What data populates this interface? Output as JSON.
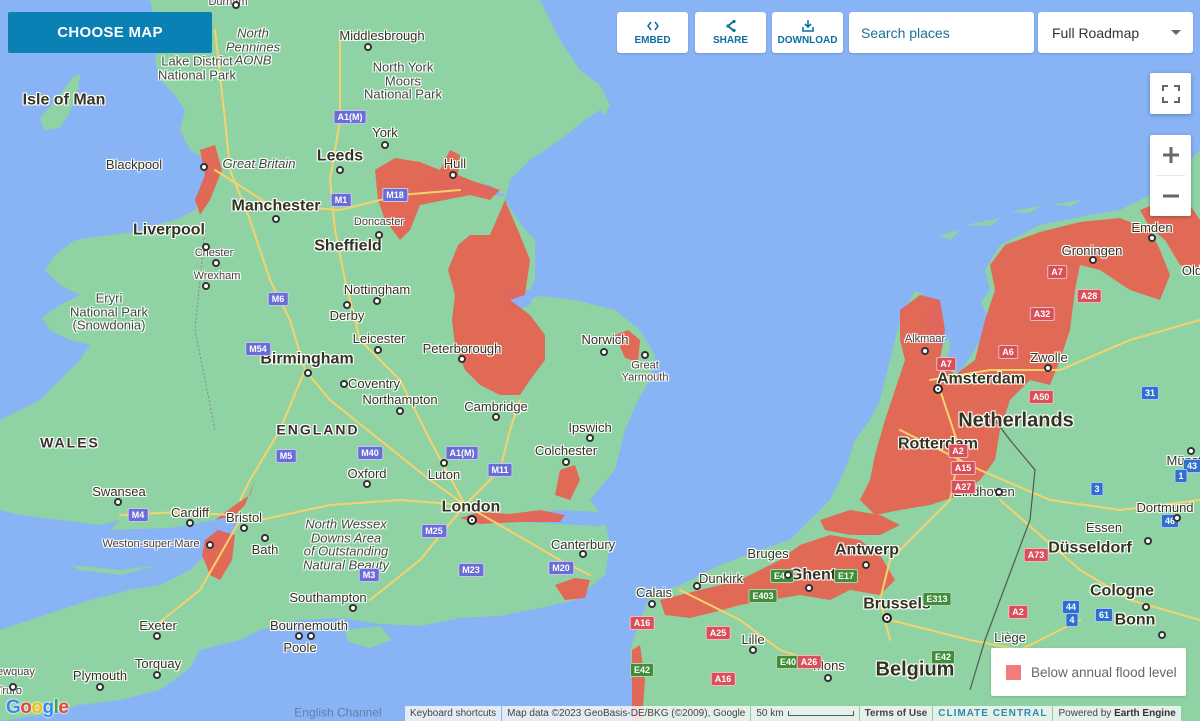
{
  "toolbar": {
    "choose_map_label": "CHOOSE MAP",
    "embed_label": "EMBED",
    "share_label": "SHARE",
    "download_label": "DOWNLOAD",
    "search_placeholder": "Search places",
    "map_type_selected": "Full Roadmap",
    "icons": {
      "embed": "code-brackets-icon",
      "share": "share-icon",
      "download": "download-icon",
      "search": "search-icon",
      "dropdown": "caret-down-icon",
      "fullscreen": "fullscreen-icon",
      "zoom_in": "plus-icon",
      "zoom_out": "minus-icon"
    }
  },
  "legend": {
    "label": "Below annual flood level",
    "color": "#f47b7b"
  },
  "colors": {
    "accent": "#0b80b4",
    "sea": "#88b3f5",
    "land": "#8fd3a4",
    "flood": "#e8614f"
  },
  "attribution": {
    "keyboard_shortcuts": "Keyboard shortcuts",
    "map_data": "Map data ©2023 GeoBasis-DE/BKG (©2009), Google",
    "scale": "50 km",
    "terms": "Terms of Use",
    "brand": "CLIMATE CENTRAL",
    "powered_prefix": "Powered by",
    "powered_name": "Earth Engine",
    "google": [
      "G",
      "o",
      "o",
      "g",
      "l",
      "e"
    ]
  },
  "map": {
    "labels": [
      {
        "text": "North Pennines AONB",
        "lines": [
          "North",
          "Pennines",
          "AONB"
        ],
        "cls": "park-i"
      },
      {
        "text": "Durham",
        "cls": "city-s"
      },
      {
        "text": "Middlesbrough",
        "cls": "city-m"
      },
      {
        "text": "Lake District National Park",
        "lines": [
          "Lake District",
          "National Park"
        ],
        "cls": "park"
      },
      {
        "text": "North York Moors National Park",
        "lines": [
          "North York",
          "Moors",
          "National Park"
        ],
        "cls": "park"
      },
      {
        "text": "Isle of Man",
        "cls": "city-l"
      },
      {
        "text": "York",
        "cls": "city-m"
      },
      {
        "text": "Blackpool",
        "cls": "city-m"
      },
      {
        "text": "Great Britain",
        "cls": "park-i"
      },
      {
        "text": "Leeds",
        "cls": "city-l"
      },
      {
        "text": "Hull",
        "cls": "city-m"
      },
      {
        "text": "Manchester",
        "cls": "city-l"
      },
      {
        "text": "Doncaster",
        "cls": "city-s"
      },
      {
        "text": "Liverpool",
        "cls": "city-l"
      },
      {
        "text": "Sheffield",
        "cls": "city-l"
      },
      {
        "text": "Chester",
        "cls": "city-s"
      },
      {
        "text": "Wrexham",
        "cls": "city-s"
      },
      {
        "text": "Nottingham",
        "cls": "city-m"
      },
      {
        "text": "Eryri National Park (Snowdonia)",
        "lines": [
          "Eryri",
          "National Park",
          "(Snowdonia)"
        ],
        "cls": "park"
      },
      {
        "text": "Derby",
        "cls": "city-m"
      },
      {
        "text": "Leicester",
        "cls": "city-m"
      },
      {
        "text": "Norwich",
        "cls": "city-m"
      },
      {
        "text": "Peterborough",
        "cls": "city-m"
      },
      {
        "text": "Great Yarmouth",
        "lines": [
          "Great",
          "Yarmouth"
        ],
        "cls": "city-s"
      },
      {
        "text": "Birmingham",
        "cls": "city-l"
      },
      {
        "text": "Coventry",
        "cls": "city-m"
      },
      {
        "text": "Northampton",
        "cls": "city-m"
      },
      {
        "text": "Cambridge",
        "cls": "city-m"
      },
      {
        "text": "ENGLAND",
        "cls": "region"
      },
      {
        "text": "WALES",
        "cls": "region"
      },
      {
        "text": "Ipswich",
        "cls": "city-m"
      },
      {
        "text": "Colchester",
        "cls": "city-m"
      },
      {
        "text": "Oxford",
        "cls": "city-m"
      },
      {
        "text": "Luton",
        "cls": "city-m"
      },
      {
        "text": "Swansea",
        "cls": "city-m"
      },
      {
        "text": "London",
        "cls": "city-l"
      },
      {
        "text": "Cardiff",
        "cls": "city-m"
      },
      {
        "text": "Bristol",
        "cls": "city-m"
      },
      {
        "text": "North Wessex Downs Area of Outstanding Natural Beauty",
        "lines": [
          "North Wessex",
          "Downs Area",
          "of Outstanding",
          "Natural Beauty"
        ],
        "cls": "park-i"
      },
      {
        "text": "Weston-super-Mare",
        "cls": "city-s"
      },
      {
        "text": "Bath",
        "cls": "city-m"
      },
      {
        "text": "Canterbury",
        "cls": "city-m"
      },
      {
        "text": "Southampton",
        "cls": "city-m"
      },
      {
        "text": "Exeter",
        "cls": "city-m"
      },
      {
        "text": "Bournemouth",
        "cls": "city-m"
      },
      {
        "text": "Poole",
        "cls": "city-m"
      },
      {
        "text": "Torquay",
        "cls": "city-m"
      },
      {
        "text": "Plymouth",
        "cls": "city-m"
      },
      {
        "text": "Newquay",
        "cls": "city-s"
      },
      {
        "text": "Truro",
        "cls": "city-s"
      },
      {
        "text": "English Channel",
        "cls": "water"
      },
      {
        "text": "Emden",
        "cls": "city-m"
      },
      {
        "text": "Groningen",
        "cls": "city-m"
      },
      {
        "text": "Old",
        "cls": "city-m"
      },
      {
        "text": "Alkmaar",
        "cls": "city-s"
      },
      {
        "text": "Zwolle",
        "cls": "city-m"
      },
      {
        "text": "Amsterdam",
        "cls": "city-l"
      },
      {
        "text": "Netherlands",
        "cls": "country"
      },
      {
        "text": "Rotterdam",
        "cls": "city-l"
      },
      {
        "text": "Münster",
        "cls": "city-m"
      },
      {
        "text": "Eindhoven",
        "cls": "city-m"
      },
      {
        "text": "Dortmund",
        "cls": "city-m"
      },
      {
        "text": "Essen",
        "cls": "city-m"
      },
      {
        "text": "Düsseldorf",
        "cls": "city-l"
      },
      {
        "text": "Bruges",
        "cls": "city-m"
      },
      {
        "text": "Antwerp",
        "cls": "city-l"
      },
      {
        "text": "Ghent",
        "cls": "city-l"
      },
      {
        "text": "Dunkirk",
        "cls": "city-m"
      },
      {
        "text": "Calais",
        "cls": "city-m"
      },
      {
        "text": "Brussels",
        "cls": "city-l"
      },
      {
        "text": "Cologne",
        "cls": "city-l"
      },
      {
        "text": "Lille",
        "cls": "city-m"
      },
      {
        "text": "Liège",
        "cls": "city-m"
      },
      {
        "text": "Bonn",
        "cls": "city-l"
      },
      {
        "text": "Mons",
        "cls": "city-m"
      },
      {
        "text": "Belgium",
        "cls": "country"
      }
    ],
    "road_shields": [
      {
        "text": "A1(M)",
        "type": "uk"
      },
      {
        "text": "M1",
        "type": "uk"
      },
      {
        "text": "M18",
        "type": "uk"
      },
      {
        "text": "M6",
        "type": "uk"
      },
      {
        "text": "M54",
        "type": "uk"
      },
      {
        "text": "M40",
        "type": "uk"
      },
      {
        "text": "M5",
        "type": "uk"
      },
      {
        "text": "A1(M)",
        "type": "uk"
      },
      {
        "text": "M11",
        "type": "uk"
      },
      {
        "text": "M4",
        "type": "uk"
      },
      {
        "text": "M25",
        "type": "uk"
      },
      {
        "text": "M3",
        "type": "uk"
      },
      {
        "text": "M23",
        "type": "uk"
      },
      {
        "text": "M20",
        "type": "uk"
      },
      {
        "text": "A7",
        "type": "eu-red"
      },
      {
        "text": "A28",
        "type": "eu-red"
      },
      {
        "text": "A32",
        "type": "eu-red"
      },
      {
        "text": "A6",
        "type": "eu-red"
      },
      {
        "text": "A7",
        "type": "eu-red"
      },
      {
        "text": "A50",
        "type": "eu-red"
      },
      {
        "text": "A2",
        "type": "eu-red"
      },
      {
        "text": "A15",
        "type": "eu-red"
      },
      {
        "text": "A27",
        "type": "eu-red"
      },
      {
        "text": "31",
        "type": "de"
      },
      {
        "text": "43",
        "type": "de"
      },
      {
        "text": "1",
        "type": "de"
      },
      {
        "text": "3",
        "type": "de"
      },
      {
        "text": "A73",
        "type": "eu-red"
      },
      {
        "text": "46",
        "type": "de"
      },
      {
        "text": "E40",
        "type": "eu-green"
      },
      {
        "text": "E17",
        "type": "eu-green"
      },
      {
        "text": "E403",
        "type": "eu-green"
      },
      {
        "text": "E313",
        "type": "eu-green"
      },
      {
        "text": "A2",
        "type": "eu-red"
      },
      {
        "text": "44",
        "type": "de"
      },
      {
        "text": "4",
        "type": "de"
      },
      {
        "text": "61",
        "type": "de"
      },
      {
        "text": "A16",
        "type": "eu-red"
      },
      {
        "text": "A25",
        "type": "eu-red"
      },
      {
        "text": "E40",
        "type": "eu-green"
      },
      {
        "text": "E42",
        "type": "eu-green"
      },
      {
        "text": "E42",
        "type": "eu-green"
      },
      {
        "text": "A16",
        "type": "eu-red"
      },
      {
        "text": "A26",
        "type": "eu-red"
      }
    ]
  }
}
